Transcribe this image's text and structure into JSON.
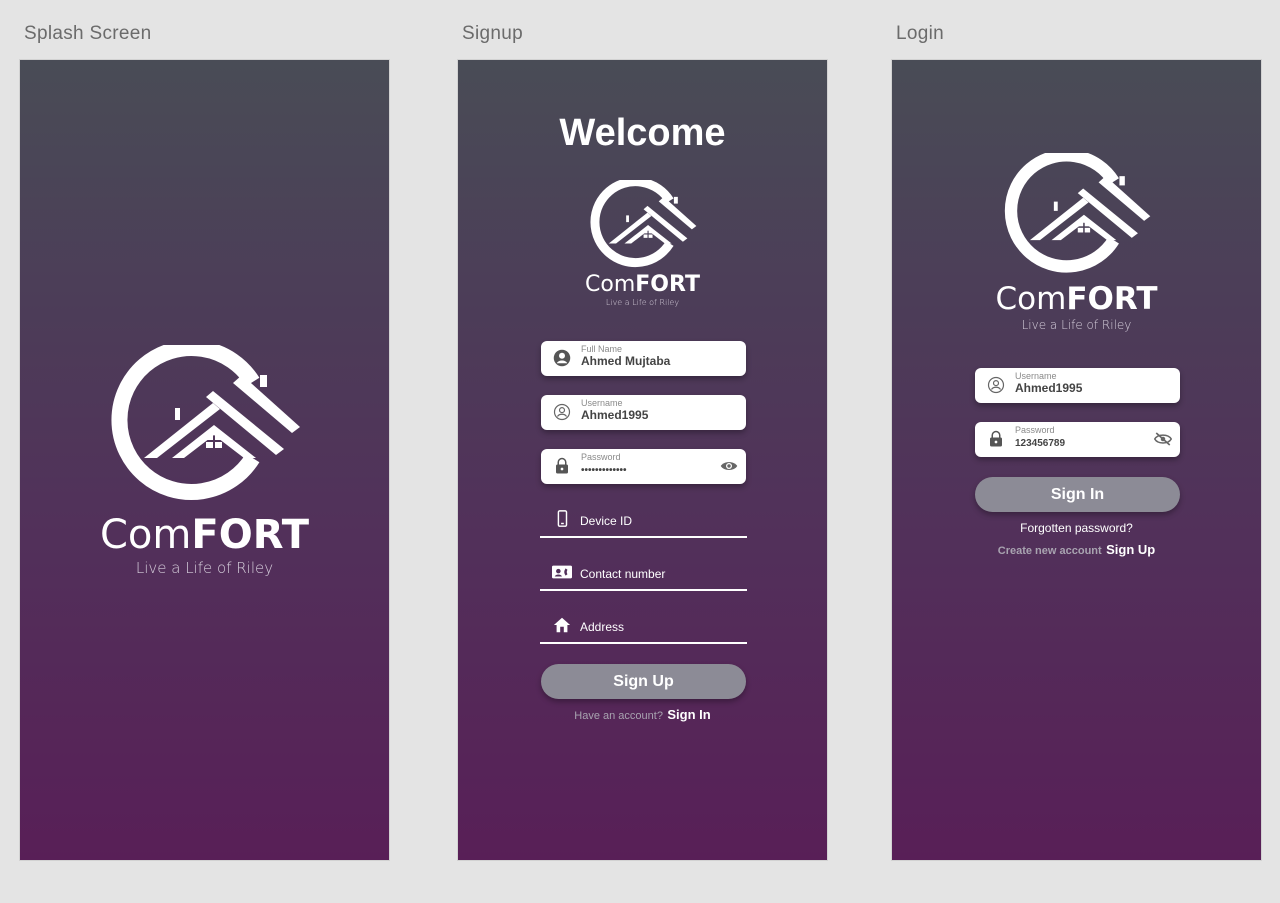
{
  "frames": {
    "splash_title": "Splash Screen",
    "signup_title": "Signup",
    "login_title": "Login"
  },
  "brand": {
    "name_light": "Com",
    "name_bold": "FORT",
    "tagline": "Live a Life of Riley",
    "logo_icon": "house-roof-circle-icon"
  },
  "signup": {
    "heading": "Welcome",
    "full_name": {
      "label": "Full Name",
      "value": "Ahmed Mujtaba",
      "icon": "person-filled-icon"
    },
    "username": {
      "label": "Username",
      "value": "Ahmed1995",
      "icon": "person-outline-icon"
    },
    "password": {
      "label": "Password",
      "value": "•••••••••••••",
      "icon": "lock-icon",
      "toggle_icon": "eye-icon"
    },
    "device_id": {
      "placeholder": "Device ID",
      "icon": "phone-icon"
    },
    "contact": {
      "placeholder": "Contact number",
      "icon": "contact-card-icon"
    },
    "address": {
      "placeholder": "Address",
      "icon": "home-icon"
    },
    "submit_label": "Sign Up",
    "footer_prompt": "Have an account?",
    "footer_link": "Sign In"
  },
  "login": {
    "username": {
      "label": "Username",
      "value": "Ahmed1995",
      "icon": "person-outline-icon"
    },
    "password": {
      "label": "Password",
      "value": "123456789",
      "icon": "lock-icon",
      "toggle_icon": "eye-off-icon"
    },
    "submit_label": "Sign In",
    "forgot_label": "Forgotten password?",
    "create_prompt": "Create new account",
    "create_link": "Sign Up"
  },
  "colors": {
    "gradient_top": "#494c56",
    "gradient_bottom": "#581f57",
    "button_bg": "#8c8b96",
    "canvas_bg": "#e4e4e4"
  }
}
